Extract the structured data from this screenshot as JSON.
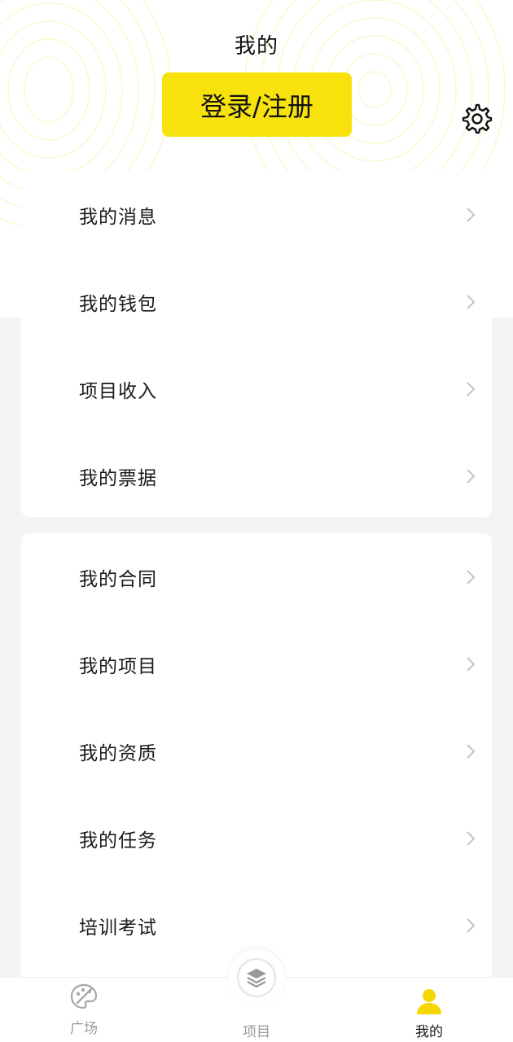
{
  "header": {
    "title": "我的",
    "login_label": "登录/注册",
    "settings_icon": "gear-icon"
  },
  "colors": {
    "accent": "#f7e20d",
    "background": "#f4f4f6",
    "active_tab": "#f7d700",
    "inactive_tab": "#9a9a9a"
  },
  "menu_group_1": [
    {
      "label": "我的消息"
    },
    {
      "label": "我的钱包"
    },
    {
      "label": "项目收入"
    },
    {
      "label": "我的票据"
    }
  ],
  "menu_group_2": [
    {
      "label": "我的合同"
    },
    {
      "label": "我的项目"
    },
    {
      "label": "我的资质"
    },
    {
      "label": "我的任务"
    },
    {
      "label": "培训考试"
    }
  ],
  "tabbar": {
    "items": [
      {
        "label": "广场",
        "icon": "palette-icon",
        "active": false
      },
      {
        "label": "项目",
        "icon": "layers-icon",
        "active": false
      },
      {
        "label": "我的",
        "icon": "user-icon",
        "active": true
      }
    ]
  }
}
